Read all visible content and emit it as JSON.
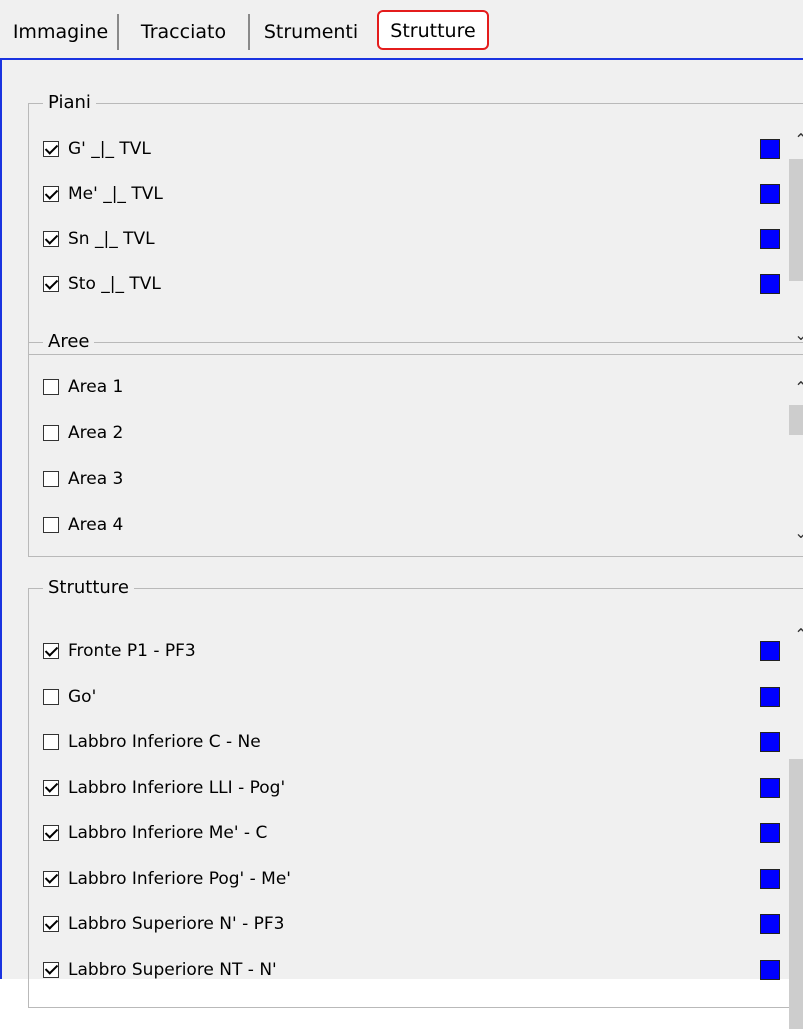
{
  "tabs": [
    {
      "label": "Immagine",
      "active": false
    },
    {
      "label": "Tracciato",
      "active": false
    },
    {
      "label": "Strumenti",
      "active": false
    },
    {
      "label": "Strutture",
      "active": true
    }
  ],
  "colors": {
    "swatch": "#0000ff",
    "active_tab_outline": "#e41c1c",
    "frame": "#1a33e0"
  },
  "icons": {
    "scroll_up": "chevron-up-icon",
    "scroll_down": "chevron-down-icon",
    "checkbox_check": "checkmark-icon"
  },
  "groups": {
    "piani": {
      "caption": "Piani",
      "items": [
        {
          "label": "G' _|_ TVL",
          "checked": true
        },
        {
          "label": "Me' _|_ TVL",
          "checked": true
        },
        {
          "label": "Sn _|_ TVL",
          "checked": true
        },
        {
          "label": "Sto _|_ TVL",
          "checked": true
        }
      ]
    },
    "aree": {
      "caption": "Aree",
      "items": [
        {
          "label": "Area 1",
          "checked": false
        },
        {
          "label": "Area 2",
          "checked": false
        },
        {
          "label": "Area 3",
          "checked": false
        },
        {
          "label": "Area 4",
          "checked": false
        }
      ]
    },
    "strutture": {
      "caption": "Strutture",
      "items": [
        {
          "label": "Fronte P1 - PF3",
          "checked": true
        },
        {
          "label": "Go'",
          "checked": false
        },
        {
          "label": "Labbro Inferiore C - Ne",
          "checked": false
        },
        {
          "label": "Labbro Inferiore LLI - Pog'",
          "checked": true
        },
        {
          "label": "Labbro Inferiore Me' - C",
          "checked": true
        },
        {
          "label": "Labbro Inferiore Pog' - Me'",
          "checked": true
        },
        {
          "label": "Labbro Superiore N' - PF3",
          "checked": true
        },
        {
          "label": "Labbro Superiore NT - N'",
          "checked": true
        }
      ]
    }
  }
}
